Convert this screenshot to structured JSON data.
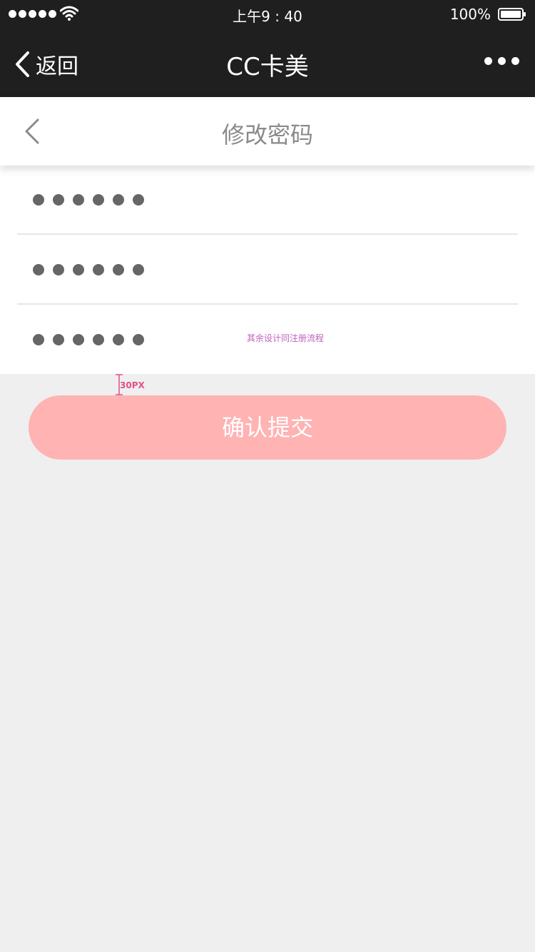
{
  "status_bar": {
    "time": "上午9 : 40",
    "battery": "100%",
    "signal_icon": "signal-dots-icon",
    "wifi_icon": "wifi-icon",
    "battery_icon": "battery-icon"
  },
  "nav": {
    "back_label": "返回",
    "title": "CC卡美",
    "back_icon": "chevron-left-icon",
    "more_icon": "more-dots-icon"
  },
  "page": {
    "title": "修改密码",
    "back_icon": "chevron-left-icon"
  },
  "form": {
    "fields": [
      {
        "value_masked": "••••••",
        "length": 6
      },
      {
        "value_masked": "••••••",
        "length": 6
      },
      {
        "value_masked": "••••••",
        "length": 6
      }
    ],
    "note": "其余设计同注册流程"
  },
  "annotation": {
    "spacing_label": "30PX"
  },
  "submit": {
    "label": "确认提交"
  },
  "colors": {
    "bar_bg": "#1f1f1f",
    "page_bg": "#efefef",
    "button_bg": "#ffb3b3",
    "note_color": "#c060c0",
    "annotation_color": "#e0508a"
  }
}
